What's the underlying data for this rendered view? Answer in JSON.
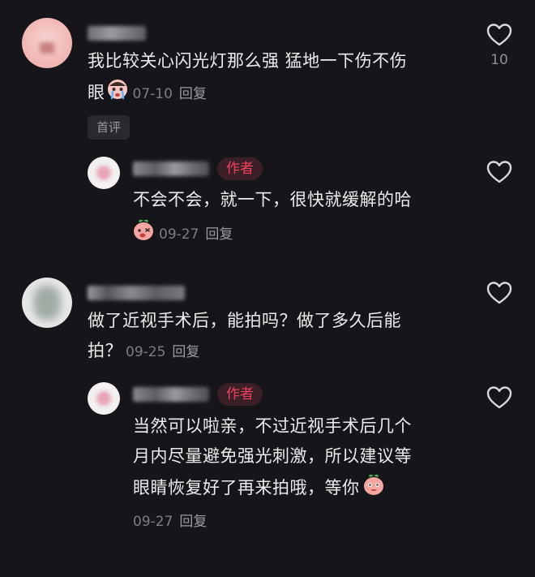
{
  "comments": [
    {
      "text_line1": "我比较关心闪光灯那么强 猛地一下伤不伤",
      "text_line2": "眼",
      "date": "07-10",
      "reply_label": "回复",
      "tag": "首评",
      "likes": "10",
      "emoji_icon": "crying-face-icon",
      "reply": {
        "author_badge": "作者",
        "text_line1": "不会不会，就一下，很快就缓解的哈",
        "date": "09-27",
        "reply_label": "回复",
        "emoji_icon": "peach-mascot-icon"
      }
    },
    {
      "text_line1": "做了近视手术后，能拍吗？做了多久后能",
      "text_line2": "拍？",
      "date": "09-25",
      "reply_label": "回复",
      "reply": {
        "author_badge": "作者",
        "text_line1": "当然可以啦亲，不过近视手术后几个",
        "text_line2": "月内尽量避免强光刺激，所以建议等",
        "text_line3": "眼睛恢复好了再来拍哦，等你",
        "date": "09-27",
        "reply_label": "回复",
        "emoji_icon": "peach-mascot-icon"
      }
    }
  ],
  "colors": {
    "background": "#16161a",
    "text": "#ececee",
    "meta": "#7c7c82",
    "author_badge": "#f0425f"
  },
  "icons": {
    "like": "heart-outline-icon"
  }
}
